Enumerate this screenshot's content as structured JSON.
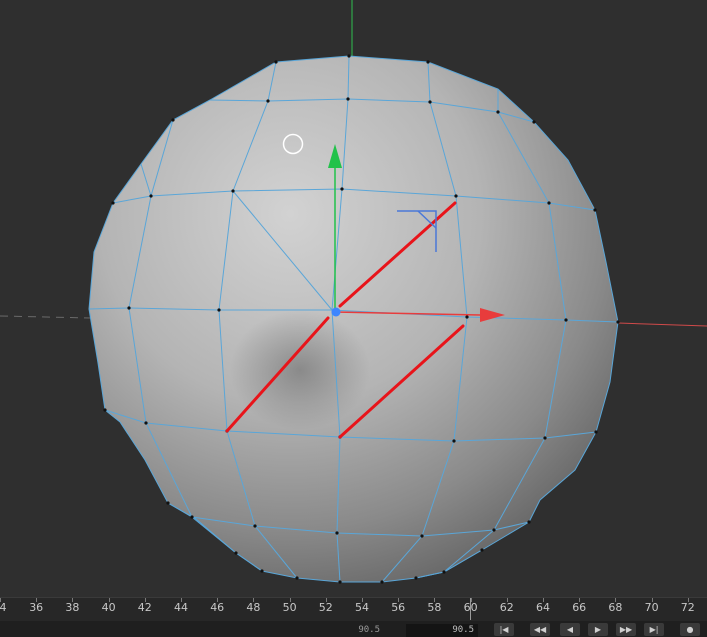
{
  "viewport": {
    "colors": {
      "background": "#2f2f2f",
      "wire": "#5aa6d8",
      "selected_edge": "#e8141a",
      "y_axis": "#21c24a",
      "x_axis": "#e83c3c"
    },
    "gizmo": {
      "x_arrow": "x-axis-arrow",
      "y_arrow": "y-axis-arrow",
      "plane_handle": "xy-plane-handle",
      "pivot": "pivot-point"
    },
    "cursor_icon": "brush-circle-icon"
  },
  "timeline": {
    "ticks": [
      "4",
      "36",
      "38",
      "40",
      "42",
      "44",
      "46",
      "48",
      "50",
      "52",
      "54",
      "56",
      "58",
      "60",
      "62",
      "64",
      "66",
      "68",
      "70",
      "72"
    ],
    "frame_start": "90.5",
    "frame_current": "90.5",
    "buttons": {
      "first": "first-frame-icon",
      "prev_key": "prev-key-icon",
      "play_back": "play-backward-icon",
      "play": "play-icon",
      "next_key": "next-key-icon",
      "last": "last-frame-icon",
      "record": "record-icon"
    }
  }
}
